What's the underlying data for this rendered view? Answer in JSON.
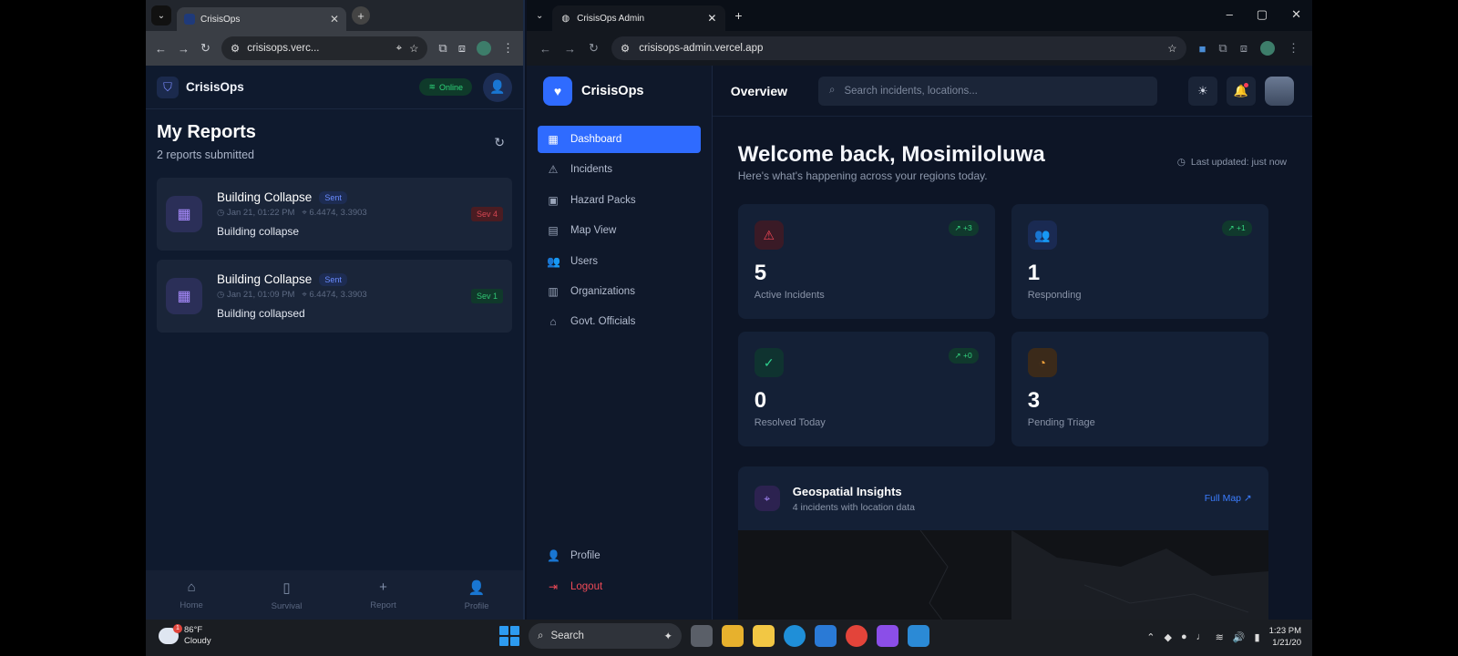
{
  "left_window": {
    "tab_title": "CrisisOps",
    "url": "crisisops.verc...",
    "app_name": "CrisisOps",
    "online_label": "Online",
    "reports_title": "My Reports",
    "reports_sub": "2 reports submitted",
    "reports": [
      {
        "title": "Building Collapse",
        "status": "Sent",
        "time": "Jan 21, 01:22 PM",
        "coords": "6.4474, 3.3903",
        "desc": "Building collapse",
        "severity": "Sev 4",
        "severity_color": "#d64652"
      },
      {
        "title": "Building Collapse",
        "status": "Sent",
        "time": "Jan 21, 01:09 PM",
        "coords": "6.4474, 3.3903",
        "desc": "Building collapsed",
        "severity": "Sev 1",
        "severity_color": "#2fc472"
      }
    ],
    "bottom_nav": [
      {
        "label": "Home",
        "icon": "home-icon"
      },
      {
        "label": "Survival",
        "icon": "book-icon"
      },
      {
        "label": "Report",
        "icon": "plus-icon"
      },
      {
        "label": "Profile",
        "icon": "user-icon"
      }
    ]
  },
  "right_window": {
    "tab_title": "CrisisOps Admin",
    "url": "crisisops-admin.vercel.app",
    "brand": "CrisisOps",
    "nav": [
      {
        "label": "Dashboard",
        "icon": "grid-icon",
        "active": true
      },
      {
        "label": "Incidents",
        "icon": "warning-icon"
      },
      {
        "label": "Hazard Packs",
        "icon": "package-icon"
      },
      {
        "label": "Map View",
        "icon": "map-icon"
      },
      {
        "label": "Users",
        "icon": "users-icon"
      },
      {
        "label": "Organizations",
        "icon": "building-icon"
      },
      {
        "label": "Govt. Officials",
        "icon": "landmark-icon"
      }
    ],
    "nav_bottom": [
      {
        "label": "Profile",
        "icon": "user-icon"
      },
      {
        "label": "Logout",
        "icon": "logout-icon"
      }
    ],
    "page_title": "Overview",
    "search_placeholder": "Search incidents, locations...",
    "welcome": "Welcome back, Mosimiloluwa",
    "welcome_sub": "Here's what's happening across your regions today.",
    "last_updated": "Last updated: just now",
    "stats": [
      {
        "value": "5",
        "label": "Active Incidents",
        "trend": "+3",
        "accent": "#ef4655"
      },
      {
        "value": "1",
        "label": "Responding",
        "trend": "+1",
        "accent": "#6d8dff"
      },
      {
        "value": "0",
        "label": "Resolved Today",
        "trend": "+0",
        "accent": "#2ed08d"
      },
      {
        "value": "3",
        "label": "Pending Triage",
        "trend": "",
        "accent": "#f5a13b"
      }
    ],
    "geo": {
      "title": "Geospatial Insights",
      "sub": "4 incidents with location data",
      "link": "Full Map"
    }
  },
  "taskbar": {
    "temp": "86°F",
    "weather": "Cloudy",
    "alert_count": "1",
    "search": "Search",
    "time": "1:23 PM",
    "date": "1/21/20"
  }
}
